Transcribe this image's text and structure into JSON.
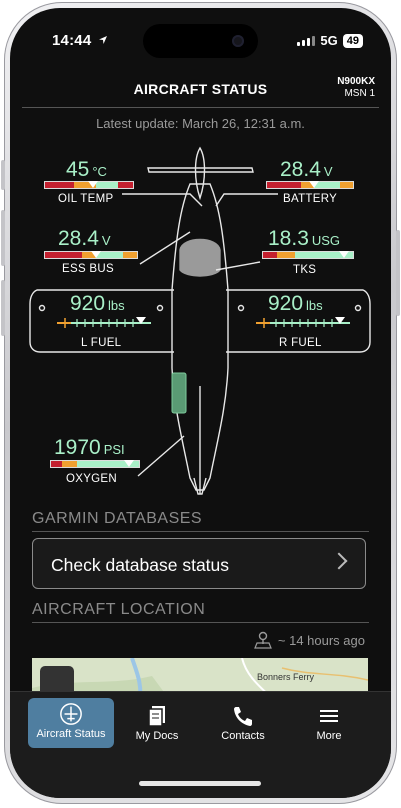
{
  "status_bar": {
    "time": "14:44",
    "network": "5G",
    "battery": "49"
  },
  "header": {
    "title": "AIRCRAFT STATUS",
    "tail_number": "N900KX",
    "msn": "MSN 1"
  },
  "last_update": "Latest update: March 26, 12:31 a.m.",
  "gauges": {
    "oil_temp": {
      "value": "45",
      "unit": "°C",
      "label": "OIL TEMP",
      "level": 0.6
    },
    "battery": {
      "value": "28.4",
      "unit": "V",
      "label": "BATTERY",
      "level": 0.55
    },
    "ess_bus": {
      "value": "28.4",
      "unit": "V",
      "label": "ESS BUS",
      "level": 0.55
    },
    "tks": {
      "value": "18.3",
      "unit": "USG",
      "label": "TKS",
      "level": 0.9
    },
    "l_fuel": {
      "value": "920",
      "unit": "lbs",
      "label": "L FUEL",
      "level": 0.9
    },
    "r_fuel": {
      "value": "920",
      "unit": "lbs",
      "label": "R FUEL",
      "level": 0.9
    },
    "oxygen": {
      "value": "1970",
      "unit": "PSI",
      "label": "OXYGEN",
      "level": 0.88
    }
  },
  "sections": {
    "databases": {
      "title": "GARMIN DATABASES",
      "button": "Check database status"
    },
    "location": {
      "title": "AIRCRAFT LOCATION",
      "updated": "~ 14 hours ago",
      "map_label": "Bonners Ferry"
    }
  },
  "tabs": [
    {
      "label": "Aircraft Status",
      "icon": "aircraft-icon",
      "active": true
    },
    {
      "label": "My Docs",
      "icon": "docs-icon",
      "active": false
    },
    {
      "label": "Contacts",
      "icon": "phone-icon",
      "active": false
    },
    {
      "label": "More",
      "icon": "menu-icon",
      "active": false
    }
  ],
  "colors": {
    "value_text": "#a9f0c8",
    "red": "#c4202f",
    "amber": "#f0a030",
    "green": "#a9f0c8",
    "active_tab": "#4f7ea0"
  }
}
